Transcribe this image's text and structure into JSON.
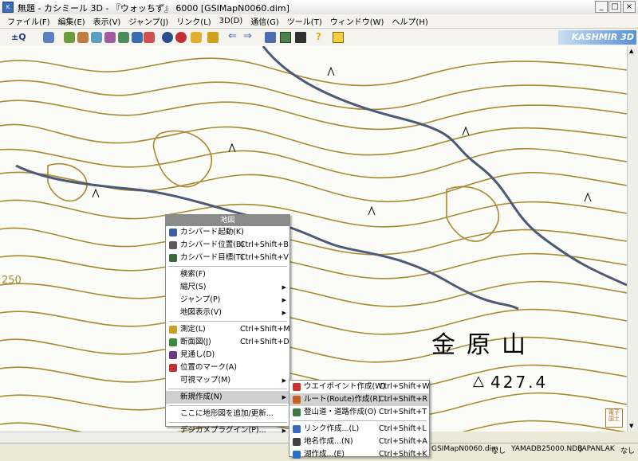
{
  "window": {
    "title": "無題 - カシミール 3D - 『ウォッちず』 6000 [GSIMapN0060.dim]",
    "minimize_glyph": "_",
    "maximize_glyph": "□",
    "close_glyph": "×"
  },
  "menubar": [
    "ファイル(F)",
    "編集(E)",
    "表示(V)",
    "ジャンプ(J)",
    "リンク(L)",
    "3D(D)",
    "通信(G)",
    "ツール(T)",
    "ウィンドウ(W)",
    "ヘルプ(H)"
  ],
  "toolbar": {
    "brand": "KASHMIR 3D"
  },
  "map": {
    "mountain_name": "金原山",
    "elevation": "427.4",
    "contour_label": "250",
    "stamp_text": "電子国土",
    "contour_color": "#a88a30",
    "road_color": "#4c5a78"
  },
  "context_menu": {
    "header": "地図",
    "items": [
      {
        "label": "カシバード起動(K)",
        "shortcut": "",
        "icon": "kashibird-icon"
      },
      {
        "label": "カシバード位置(B)",
        "shortcut": "Ctrl+Shift+B",
        "icon": "camera-pos-icon"
      },
      {
        "label": "カシバード目標(T)",
        "shortcut": "Ctrl+Shift+V",
        "icon": "target-icon"
      },
      {
        "sep": true
      },
      {
        "label": "検索(F)",
        "shortcut": ""
      },
      {
        "label": "縮尺(S)",
        "shortcut": "",
        "submenu": true
      },
      {
        "label": "ジャンプ(P)",
        "shortcut": "",
        "submenu": true
      },
      {
        "label": "地図表示(V)",
        "shortcut": "",
        "submenu": true
      },
      {
        "sep": true
      },
      {
        "label": "測定(L)",
        "shortcut": "Ctrl+Shift+M",
        "icon": "ruler-icon"
      },
      {
        "label": "断面図(J)",
        "shortcut": "Ctrl+Shift+D",
        "icon": "profile-icon"
      },
      {
        "label": "見通し(D)",
        "shortcut": "",
        "icon": "sightline-icon"
      },
      {
        "label": "位置のマーク(A)",
        "shortcut": "",
        "icon": "pin-icon"
      },
      {
        "label": "可視マップ(M)",
        "shortcut": "",
        "submenu": true
      },
      {
        "sep": true
      },
      {
        "label": "新規作成(N)",
        "shortcut": "",
        "submenu": true,
        "highlight": true
      },
      {
        "sep": true
      },
      {
        "label": "ここに地形図を追加/更新...",
        "shortcut": ""
      },
      {
        "sep": true
      },
      {
        "label": "デジカメプラグイン(P)...",
        "shortcut": "",
        "submenu": true
      }
    ]
  },
  "submenu": {
    "items": [
      {
        "label": "ウエイポイント作成(W)",
        "shortcut": "Ctrl+Shift+W",
        "icon": "waypoint-icon"
      },
      {
        "label": "ルート(Route)作成(R)",
        "shortcut": "Ctrl+Shift+R",
        "icon": "route-icon",
        "highlight": true
      },
      {
        "label": "登山道・道路作成(O)",
        "shortcut": "Ctrl+Shift+T",
        "icon": "trail-icon"
      },
      {
        "sep": true
      },
      {
        "label": "リンク作成...(L)",
        "shortcut": "Ctrl+Shift+L",
        "icon": "link-icon"
      },
      {
        "label": "地名作成...(N)",
        "shortcut": "Ctrl+Shift+A",
        "icon": "placename-icon"
      },
      {
        "label": "湖作成...(E)",
        "shortcut": "Ctrl+Shift+K",
        "icon": "lake-icon"
      }
    ]
  },
  "status": [
    "GSIMapN0060.dim",
    "なし",
    "YAMADB25000.NDB",
    "JAPANLAK",
    "なし"
  ]
}
